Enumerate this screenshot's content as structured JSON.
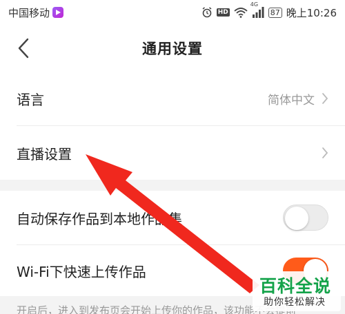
{
  "status_bar": {
    "carrier": "中国移动",
    "network_label": "4G",
    "battery": "87",
    "time": "晚上10:26",
    "hd": "HD",
    "icons": [
      "alarm-icon",
      "hd-icon",
      "wifi-icon",
      "signal-icon",
      "battery-icon",
      "carrier-app-icon"
    ]
  },
  "header": {
    "title": "通用设置",
    "back_icon": "chevron-left-icon"
  },
  "settings": {
    "language": {
      "label": "语言",
      "value": "简体中文"
    },
    "live": {
      "label": "直播设置"
    },
    "auto_save": {
      "label": "自动保存作品到本地作品集",
      "enabled": false
    },
    "wifi_upload": {
      "label": "Wi-Fi下快速上传作品",
      "enabled": true
    }
  },
  "footnote": "开启后，进入到发布页会开始上传你的作品，该功能不会提前",
  "watermark": {
    "title": "百科全说",
    "subtitle": "助你轻松解决"
  },
  "colors": {
    "accent": "#ff5b1a",
    "arrow": "#f0281e",
    "watermark_green": "#14a34a",
    "section_gap": "#f3f3f3"
  }
}
